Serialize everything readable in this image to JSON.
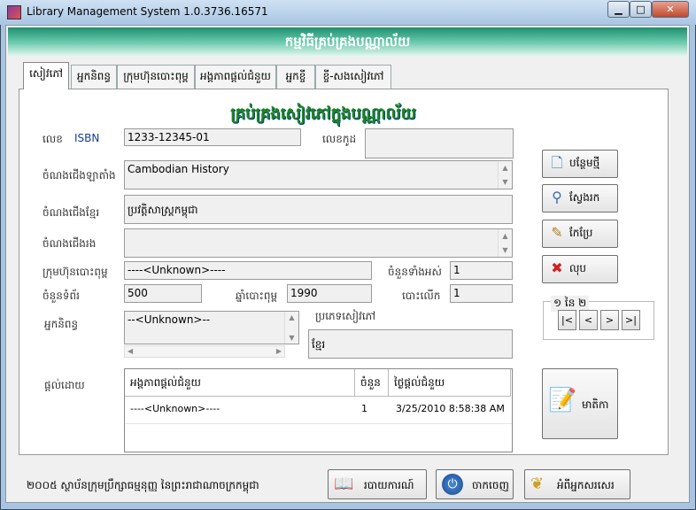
{
  "window": {
    "title": "Library Management System  1.0.3736.16571",
    "min": "▁",
    "max": "□",
    "close": "✕"
  },
  "banner": "កម្មវិធីគ្រប់គ្រងបណ្ណាល័យ",
  "tabs": [
    "សៀវភៅ",
    "អ្នកនិពន្ធ",
    "ក្រុមហ៊ុនបោះពុម្ព",
    "អង្គភាពផ្តល់ជំនួយ",
    "អ្នកខ្ចី",
    "ខ្ចី-សងសៀវភៅ"
  ],
  "heading": "គ្រប់គ្រងសៀវភៅក្នុងបណ្ណាល័យ",
  "form": {
    "id_label": "លេខ",
    "isbn_label": "ISBN",
    "isbn_value": "1233-12345-01",
    "lib_no_label": "លេខកូដ",
    "lib_no_value": "",
    "title_latin_label": "ចំណងជើងឡាតាំង",
    "title_latin_value": "Cambodian History",
    "title_khmer_label": "ចំណងជើងខ្មែរ",
    "title_khmer_value": "ប្រវត្តិសាស្ត្រកម្ពុជា",
    "title_other_label": "ចំណងជើងរង",
    "title_other_value": "",
    "publisher_label": "ក្រុមហ៊ុនបោះពុម្ព",
    "publisher_value": "----<Unknown>----",
    "total_qty_label": "ចំនួនទាំងអស់",
    "total_qty_value": "1",
    "pages_label": "ចំនួនទំព័រ",
    "pages_value": "500",
    "year_label": "ឆ្នាំបោះពុម្ព",
    "year_value": "1990",
    "edition_label": "បោះលើក",
    "edition_value": "1",
    "author_label": "អ្នកនិពន្ធ",
    "author_value": "--<Unknown>--",
    "category_label": "ប្រភេទសៀវភៅ",
    "category_value": "ខ្មែរ",
    "donor_label": "ផ្តល់ដោយ"
  },
  "donor_table": {
    "columns": [
      "អង្គភាពផ្តល់ជំនួយ",
      "ចំនួន",
      "ថ្ងៃផ្តល់ជំនួយ"
    ],
    "rows": [
      [
        "----<Unknown>----",
        "1",
        "3/25/2010 8:58:38 AM"
      ]
    ]
  },
  "buttons": {
    "new": "បន្ថែមថ្មី",
    "search": "ស្វែងរក",
    "edit": "កែប្រែ",
    "delete": "លុប",
    "contents": "មាតិកា"
  },
  "pager": {
    "label": "១ នៃ ២",
    "first": "|<",
    "prev": "<",
    "next": ">",
    "last": ">|"
  },
  "footer": {
    "text": "២០០៥ ស្ថាប័នក្រុមប្រឹក្សាធម្មនុញ្ញ នៃព្រះរាជាណាចក្រកម្ពុជា",
    "report": "របាយការណ៍",
    "exit": "ចាកចេញ",
    "about": "អំពីអ្នកសរសេរ"
  }
}
